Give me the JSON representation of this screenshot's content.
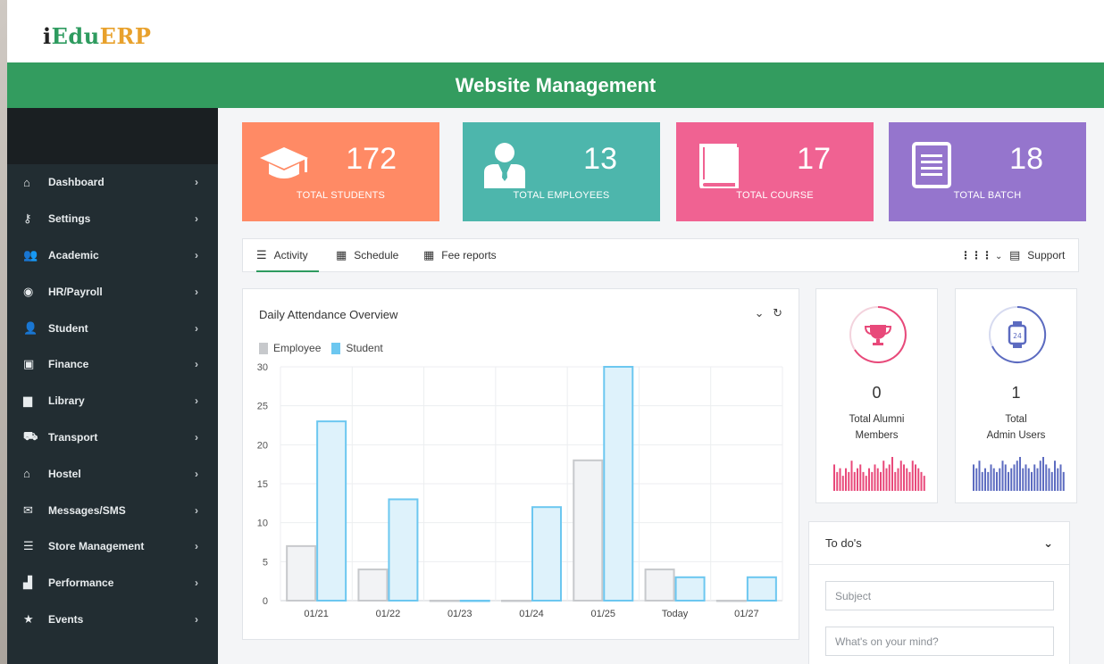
{
  "app": {
    "logo_i": "i",
    "logo_edu": "Edu",
    "logo_erp": "ERP",
    "banner_title": "Website Management"
  },
  "sidebar": {
    "items": [
      {
        "label": "Dashboard",
        "icon": "home-icon",
        "glyph": "⌂"
      },
      {
        "label": "Settings",
        "icon": "key-icon",
        "glyph": "⚷"
      },
      {
        "label": "Academic",
        "icon": "users-icon",
        "glyph": "👥"
      },
      {
        "label": "HR/Payroll",
        "icon": "eye-icon",
        "glyph": "◉"
      },
      {
        "label": "Student",
        "icon": "user-icon",
        "glyph": "👤"
      },
      {
        "label": "Finance",
        "icon": "money-icon",
        "glyph": "▣"
      },
      {
        "label": "Library",
        "icon": "book-icon",
        "glyph": "▆"
      },
      {
        "label": "Transport",
        "icon": "truck-icon",
        "glyph": "⛟"
      },
      {
        "label": "Hostel",
        "icon": "house-icon",
        "glyph": "⌂"
      },
      {
        "label": "Messages/SMS",
        "icon": "envelope-icon",
        "glyph": "✉"
      },
      {
        "label": "Store Management",
        "icon": "list-icon",
        "glyph": "☰"
      },
      {
        "label": "Performance",
        "icon": "chart-icon",
        "glyph": "▟"
      },
      {
        "label": "Events",
        "icon": "star-icon",
        "glyph": "★"
      }
    ],
    "chevron": "›"
  },
  "stats": [
    {
      "value": "172",
      "label": "TOTAL STUDENTS",
      "color": "#ff8a65",
      "icon": "graduation-cap-icon"
    },
    {
      "value": "13",
      "label": "TOTAL EMPLOYEES",
      "color": "#4db6ac",
      "icon": "employee-icon"
    },
    {
      "value": "17",
      "label": "TOTAL COURSE",
      "color": "#f06292",
      "icon": "book-icon"
    },
    {
      "value": "18",
      "label": "TOTAL BATCH",
      "color": "#9575cd",
      "icon": "document-icon"
    }
  ],
  "tabs": {
    "activity": "Activity",
    "schedule": "Schedule",
    "fee_reports": "Fee reports",
    "support": "Support"
  },
  "chart_card": {
    "title": "Daily Attendance Overview"
  },
  "chart_data": {
    "type": "bar",
    "title": "Daily Attendance Overview",
    "categories": [
      "01/21",
      "01/22",
      "01/23",
      "01/24",
      "01/25",
      "Today",
      "01/27"
    ],
    "series": [
      {
        "name": "Employee",
        "values": [
          7,
          4,
          0,
          0,
          18,
          4,
          0
        ],
        "fill": "#f2f3f5",
        "stroke": "#c7c9cc"
      },
      {
        "name": "Student",
        "values": [
          23,
          13,
          0,
          12,
          30,
          3,
          3
        ],
        "fill": "#def2fb",
        "stroke": "#6cc7f0"
      }
    ],
    "yticks": [
      0,
      5,
      10,
      15,
      20,
      25,
      30
    ],
    "ylim": [
      0,
      30
    ],
    "grid": true,
    "legend": "top-left"
  },
  "kpis": [
    {
      "value": "0",
      "line1": "Total Alumni",
      "line2": "Members",
      "color": "#e8497a",
      "icon": "trophy-icon",
      "spark": [
        7,
        5,
        6,
        4,
        6,
        5,
        8,
        5,
        6,
        7,
        5,
        4,
        6,
        5,
        7,
        6,
        5,
        8,
        6,
        7,
        9,
        5,
        6,
        8,
        7,
        6,
        5,
        8,
        7,
        6,
        5,
        4
      ]
    },
    {
      "value": "1",
      "line1": "Total",
      "line2": "Admin Users",
      "color": "#5c6bc0",
      "icon": "smartwatch-icon",
      "spark": [
        7,
        6,
        8,
        5,
        6,
        5,
        7,
        6,
        5,
        6,
        8,
        7,
        5,
        6,
        7,
        8,
        9,
        6,
        7,
        6,
        5,
        7,
        6,
        8,
        9,
        7,
        6,
        5,
        8,
        6,
        7,
        5
      ]
    }
  ],
  "todo": {
    "title": "To do's",
    "subject_placeholder": "Subject",
    "mind_placeholder": "What's on your mind?"
  }
}
